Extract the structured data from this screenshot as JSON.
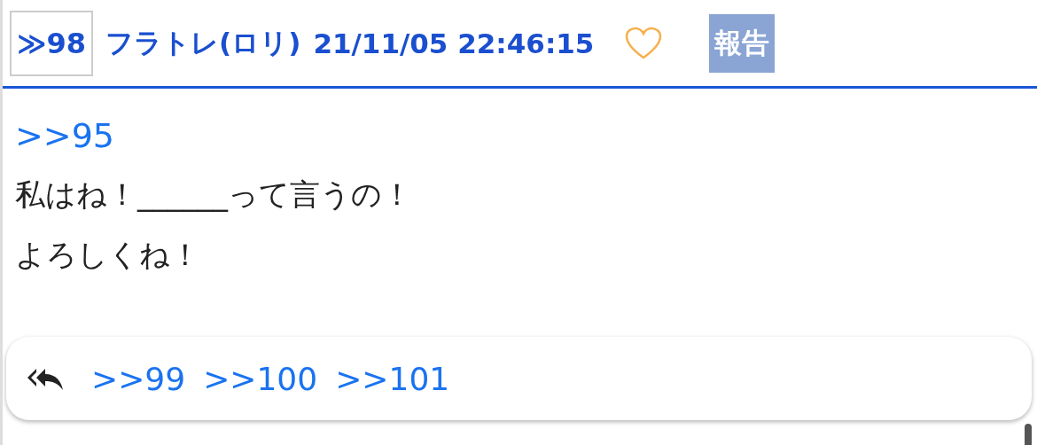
{
  "post": {
    "number": "≫98",
    "author": "フラトレ(ロリ)",
    "timestamp": "21/11/05 22:46:15",
    "liked": false,
    "report_button": "報告"
  },
  "body": {
    "anchor": ">>95",
    "lines": [
      "私はね！______って言うの！",
      "よろしくね！"
    ]
  },
  "replies": {
    "links": [
      ">>99",
      ">>100",
      ">>101"
    ]
  }
}
